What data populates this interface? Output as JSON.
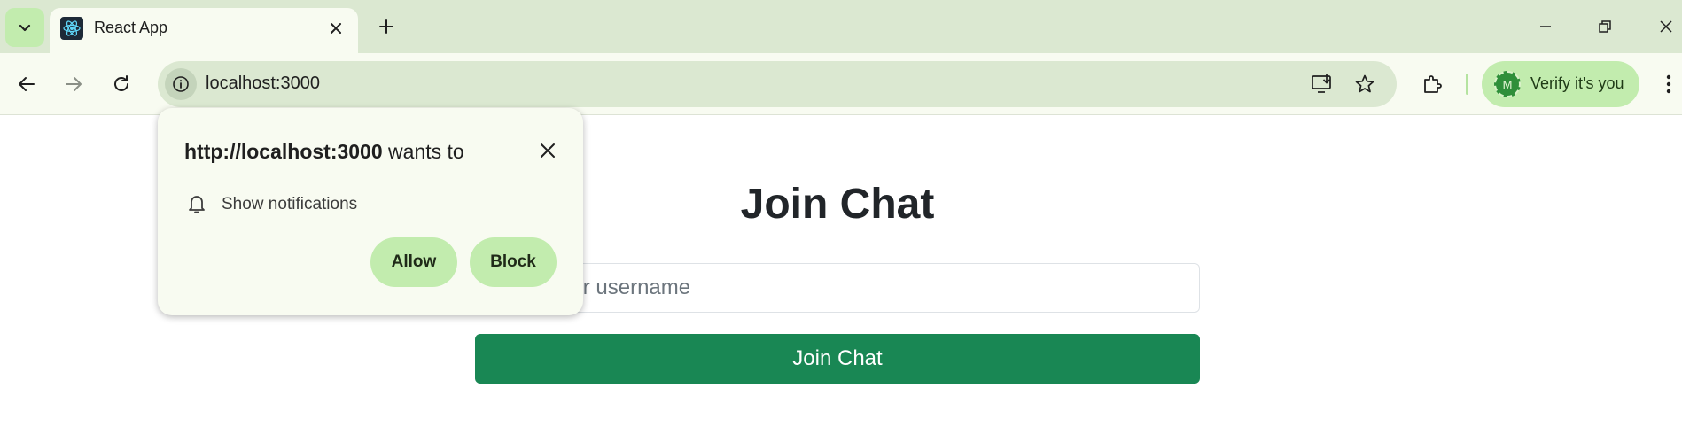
{
  "browser": {
    "tab": {
      "title": "React App"
    },
    "address_bar": {
      "url": "localhost:3000"
    },
    "profile": {
      "initial": "M",
      "label": "Verify it's you"
    },
    "colors": {
      "frame": "#dbe8d1",
      "toolbar": "#f8fbf1",
      "accent": "#c2ecae"
    }
  },
  "permission_popup": {
    "origin": "http://localhost:3000",
    "suffix": " wants to",
    "permission_label": "Show notifications",
    "allow_label": "Allow",
    "block_label": "Block"
  },
  "page": {
    "heading": "Join Chat",
    "username_placeholder": "Enter your username",
    "join_button_label": "Join Chat",
    "colors": {
      "primary_button": "#198754",
      "heading": "#212529"
    }
  }
}
